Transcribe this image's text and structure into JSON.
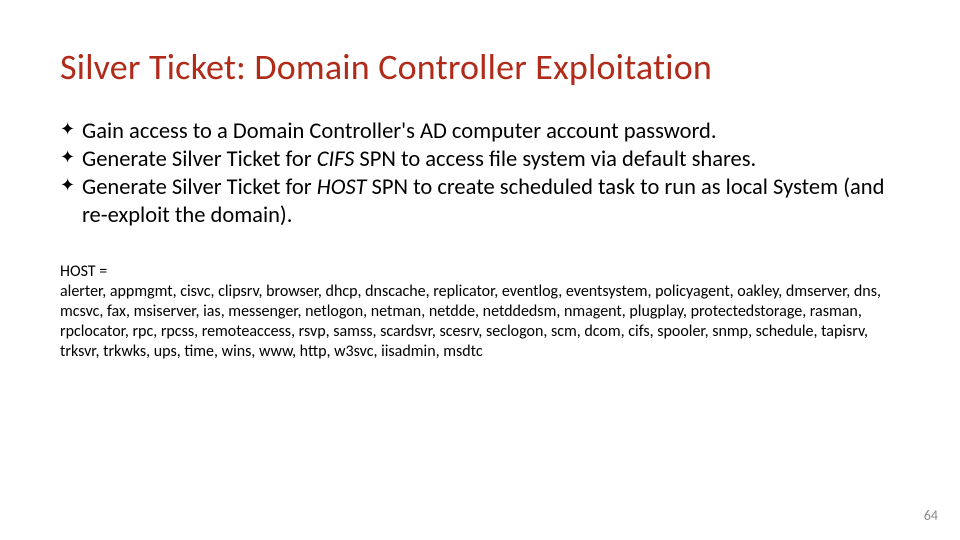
{
  "title": "Silver Ticket: Domain Controller Exploitation",
  "bullets": [
    {
      "pre": "Gain access to a Domain Controller's AD computer account password.",
      "em": "",
      "post": ""
    },
    {
      "pre": "Generate Silver Ticket for ",
      "em": "CIFS",
      "post": " SPN to access file system via default shares."
    },
    {
      "pre": "Generate Silver Ticket for ",
      "em": "HOST",
      "post": " SPN to create scheduled task to run as local System (and re-exploit the domain)."
    }
  ],
  "host_label": "HOST =",
  "host_list": "alerter, appmgmt, cisvc, clipsrv, browser, dhcp, dnscache, replicator, eventlog, eventsystem, policyagent, oakley, dmserver, dns, mcsvc, fax, msiserver, ias, messenger, netlogon, netman, netdde, netddedsm, nmagent, plugplay, protectedstorage, rasman, rpclocator, rpc, rpcss, remoteaccess, rsvp, samss, scardsvr, scesrv, seclogon, scm, dcom, cifs, spooler, snmp, schedule, tapisrv, trksvr, trkwks, ups, time, wins, www, http, w3svc, iisadmin, msdtc",
  "page_number": "64"
}
